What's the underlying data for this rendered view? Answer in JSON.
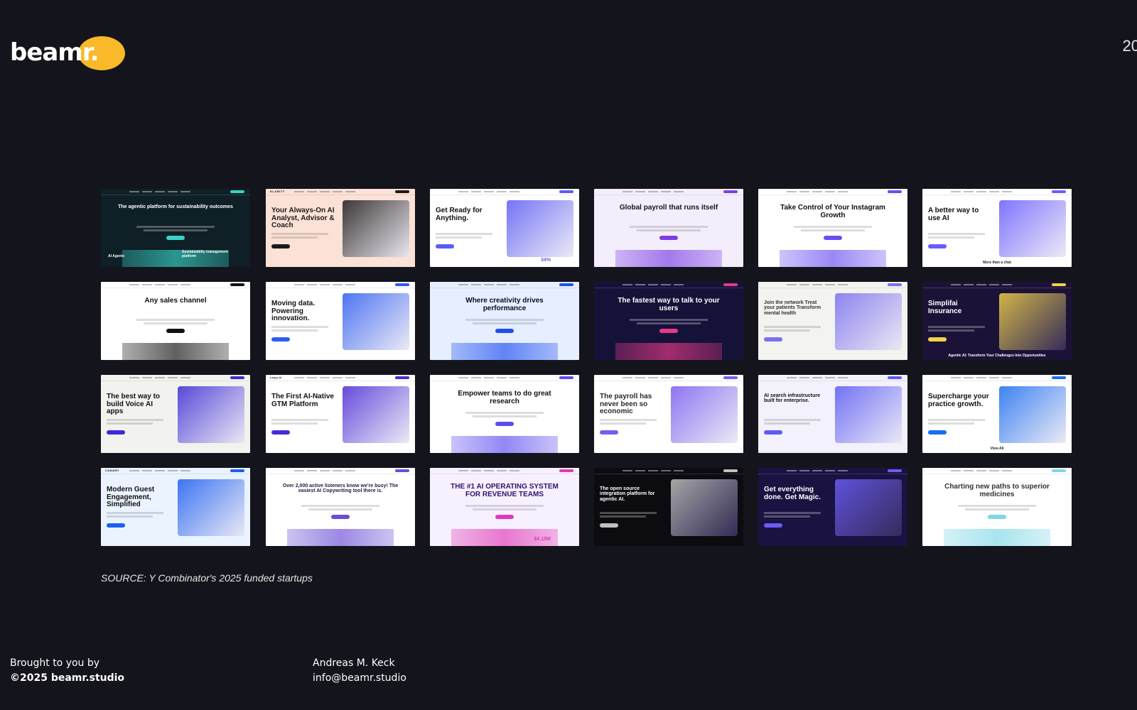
{
  "brand": {
    "name": "beamr",
    "accent": "#f9b928"
  },
  "page_number": "20",
  "background": "#14141c",
  "thumbnails": [
    {
      "headline": "The agentic platform for sustainability outcomes",
      "bg": "#0f1f26",
      "fg": "#ffffff",
      "accent": "#3ad1c6",
      "tagline": "AI Agents",
      "tagline2": "Sustainability management platform"
    },
    {
      "headline": "Your Always-On AI Analyst, Advisor & Coach",
      "bg": "#fbe1d6",
      "fg": "#1b1b1b",
      "accent": "#1a1a1a",
      "brand": "KLARITY"
    },
    {
      "headline": "Get Ready for Anything.",
      "bg": "#ffffff",
      "fg": "#111111",
      "accent": "#5b5cf6",
      "stat": "34%"
    },
    {
      "headline": "Global payroll that runs itself",
      "bg": "#f4eefc",
      "fg": "#151515",
      "accent": "#7b3fe4"
    },
    {
      "headline": "Take Control of Your Instagram Growth",
      "bg": "#ffffff",
      "fg": "#111111",
      "accent": "#6b4cf0"
    },
    {
      "headline": "A better way to use AI",
      "bg": "#ffffff",
      "fg": "#111111",
      "accent": "#6a5cff",
      "tagline": "More than a chat"
    },
    {
      "headline": "Any sales channel",
      "bg": "#ffffff",
      "fg": "#111111",
      "accent": "#111111"
    },
    {
      "headline": "Moving data. Powering innovation.",
      "bg": "#ffffff",
      "fg": "#111111",
      "accent": "#2f5cf0"
    },
    {
      "headline": "Where creativity drives performance",
      "bg": "#e6efff",
      "fg": "#0c0c20",
      "accent": "#1f4ef0"
    },
    {
      "headline": "The fastest way to talk to your users",
      "bg": "#15123a",
      "fg": "#ffffff",
      "accent": "#e63a86"
    },
    {
      "headline": "Join the network Treat your patients Transform mental health",
      "bg": "#f3f3f0",
      "fg": "#333333",
      "accent": "#7b6ff0"
    },
    {
      "headline": "Simplifai Insurance",
      "bg": "#1c1238",
      "fg": "#ffffff",
      "accent": "#f0d24a",
      "tagline": "Agentic AI: Transform Your Challenges Into Opportunities"
    },
    {
      "headline": "The best way to build Voice AI apps",
      "bg": "#f2f2ee",
      "fg": "#111111",
      "accent": "#3c2bd6"
    },
    {
      "headline": "The First AI-Native GTM Platform",
      "bg": "#ffffff",
      "fg": "#111111",
      "accent": "#4b2ad6",
      "brand": "copy.ai"
    },
    {
      "headline": "Empower teams to do great research",
      "bg": "#ffffff",
      "fg": "#111111",
      "accent": "#5a4cf0"
    },
    {
      "headline": "The payroll has never been so economic",
      "bg": "#ffffff",
      "fg": "#2b2b2b",
      "accent": "#7b5cf0"
    },
    {
      "headline": "AI search infrastructure built for enterprise.",
      "bg": "#f3f1fb",
      "fg": "#111111",
      "accent": "#5b5cf6"
    },
    {
      "headline": "Supercharge your practice growth.",
      "bg": "#ffffff",
      "fg": "#111111",
      "accent": "#1a6df0",
      "tagline": "View All"
    },
    {
      "headline": "Modern Guest Engagement, Simplified",
      "bg": "#eaf3ff",
      "fg": "#111111",
      "accent": "#1d5ef0",
      "brand": "CANARY"
    },
    {
      "headline": "Over 2,000 active listeners know we're busy! The easiest AI Copywriting tool there is.",
      "bg": "#ffffff",
      "fg": "#222244",
      "accent": "#6a4cd6"
    },
    {
      "headline": "THE #1 AI OPERATING SYSTEM FOR REVENUE TEAMS",
      "bg": "#f7f0ff",
      "fg": "#2a1470",
      "accent": "#e13ab6",
      "stat": "$4.15M"
    },
    {
      "headline": "The open source integration platform for agentic AI.",
      "bg": "#0b0b10",
      "fg": "#ffffff",
      "accent": "#c0c0c0"
    },
    {
      "headline": "Get everything done. Get Magic.",
      "bg": "#1a1240",
      "fg": "#ffffff",
      "accent": "#6c5cf6"
    },
    {
      "headline": "Charting new paths to superior medicines",
      "bg": "#ffffff",
      "fg": "#333333",
      "accent": "#7fd6e6"
    }
  ],
  "source_note": "SOURCE: Y Combinator's 2025 funded startups",
  "footer": {
    "line1": "Brought to you by",
    "line2": "©2025 beamr.studio",
    "author": "Andreas M. Keck",
    "email": "info@beamr.studio"
  }
}
